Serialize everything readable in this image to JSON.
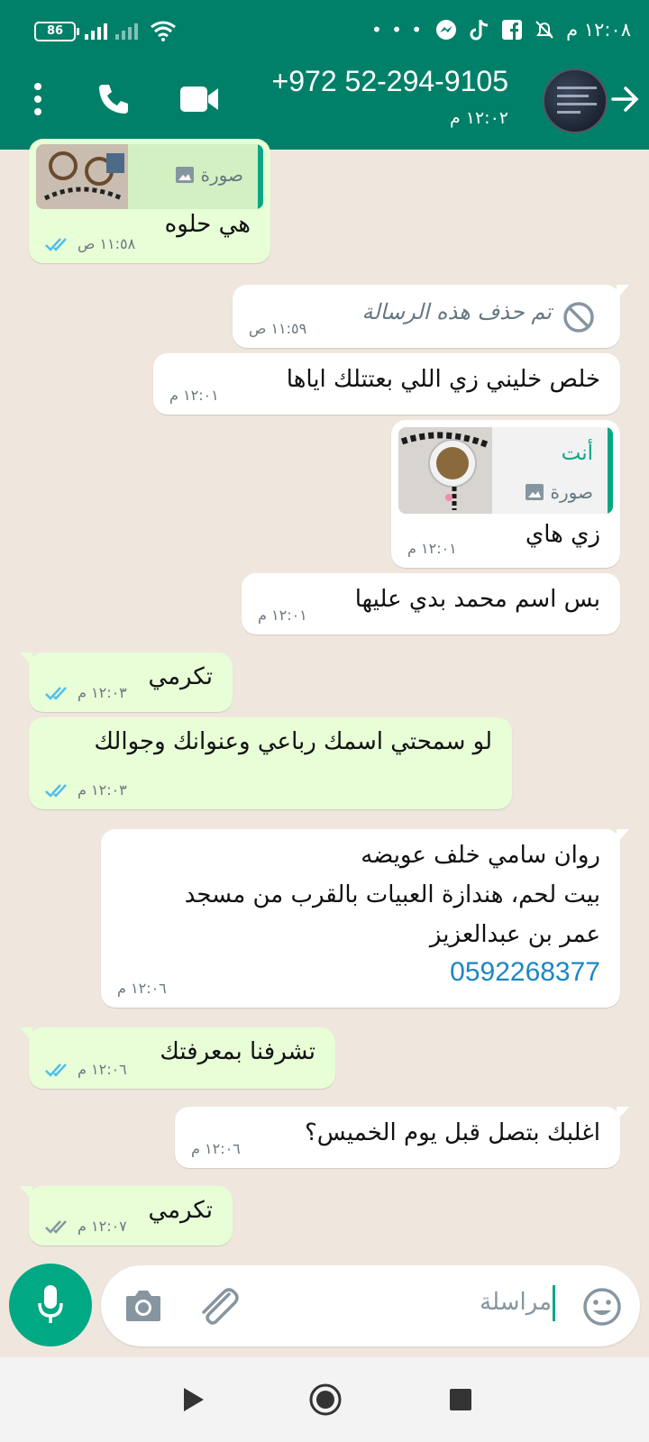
{
  "status_bar": {
    "battery": "86",
    "time": "١٢:٠٨ م",
    "more": "• • •"
  },
  "header": {
    "contact_name": "+972 52-294-9105",
    "last_seen": "١٢:٠٢ م"
  },
  "messages": [
    {
      "dir": "out",
      "quote_type": "صورة",
      "text": "هي حلوه",
      "time": "١١:٥٨ ص",
      "ticks": "read"
    },
    {
      "dir": "in",
      "deleted": true,
      "text": "تم حذف هذه الرسالة",
      "time": "١١:٥٩ ص"
    },
    {
      "dir": "in",
      "text": "خلص خليني زي اللي بعتتلك اياها",
      "time": "١٢:٠١ م"
    },
    {
      "dir": "in",
      "quote_author": "أنت",
      "quote_type": "صورة",
      "text": "زي هاي",
      "time": "١٢:٠١ م"
    },
    {
      "dir": "in",
      "text": "بس اسم محمد بدي عليها",
      "time": "١٢:٠١ م"
    },
    {
      "dir": "out",
      "text": "تكرمي",
      "time": "١٢:٠٣ م",
      "ticks": "read"
    },
    {
      "dir": "out",
      "text": "لو سمحتي اسمك رباعي وعنوانك وجوالك",
      "time": "١٢:٠٣ م",
      "ticks": "read"
    },
    {
      "dir": "in",
      "lines": [
        "روان سامي خلف عويضه",
        "بيت لحم، هندازة  العبيات بالقرب من مسجد",
        "عمر بن عبدالعزيز"
      ],
      "phone": "0592268377",
      "time": "١٢:٠٦ م"
    },
    {
      "dir": "out",
      "text": "تشرفنا بمعرفتك",
      "time": "١٢:٠٦ م",
      "ticks": "read"
    },
    {
      "dir": "in",
      "text": "اغلبك بتصل قبل يوم الخميس؟",
      "time": "١٢:٠٦ م"
    },
    {
      "dir": "out",
      "text": "تكرمي",
      "time": "١٢:٠٧ م",
      "ticks": "delivered"
    }
  ],
  "composer": {
    "placeholder": "مراسلة"
  },
  "colors": {
    "header": "#008069",
    "outgoing_bubble": "#e7fed7",
    "incoming_bubble": "#ffffff",
    "read_tick": "#53bdeb",
    "accent": "#00a884",
    "link": "#1d86c3"
  },
  "icons": [
    "menu-icon",
    "voice-call-icon",
    "video-call-icon",
    "back-arrow-icon",
    "emoji-icon",
    "attach-icon",
    "camera-icon",
    "mic-icon",
    "back-nav-icon",
    "home-nav-icon",
    "recents-nav-icon"
  ]
}
